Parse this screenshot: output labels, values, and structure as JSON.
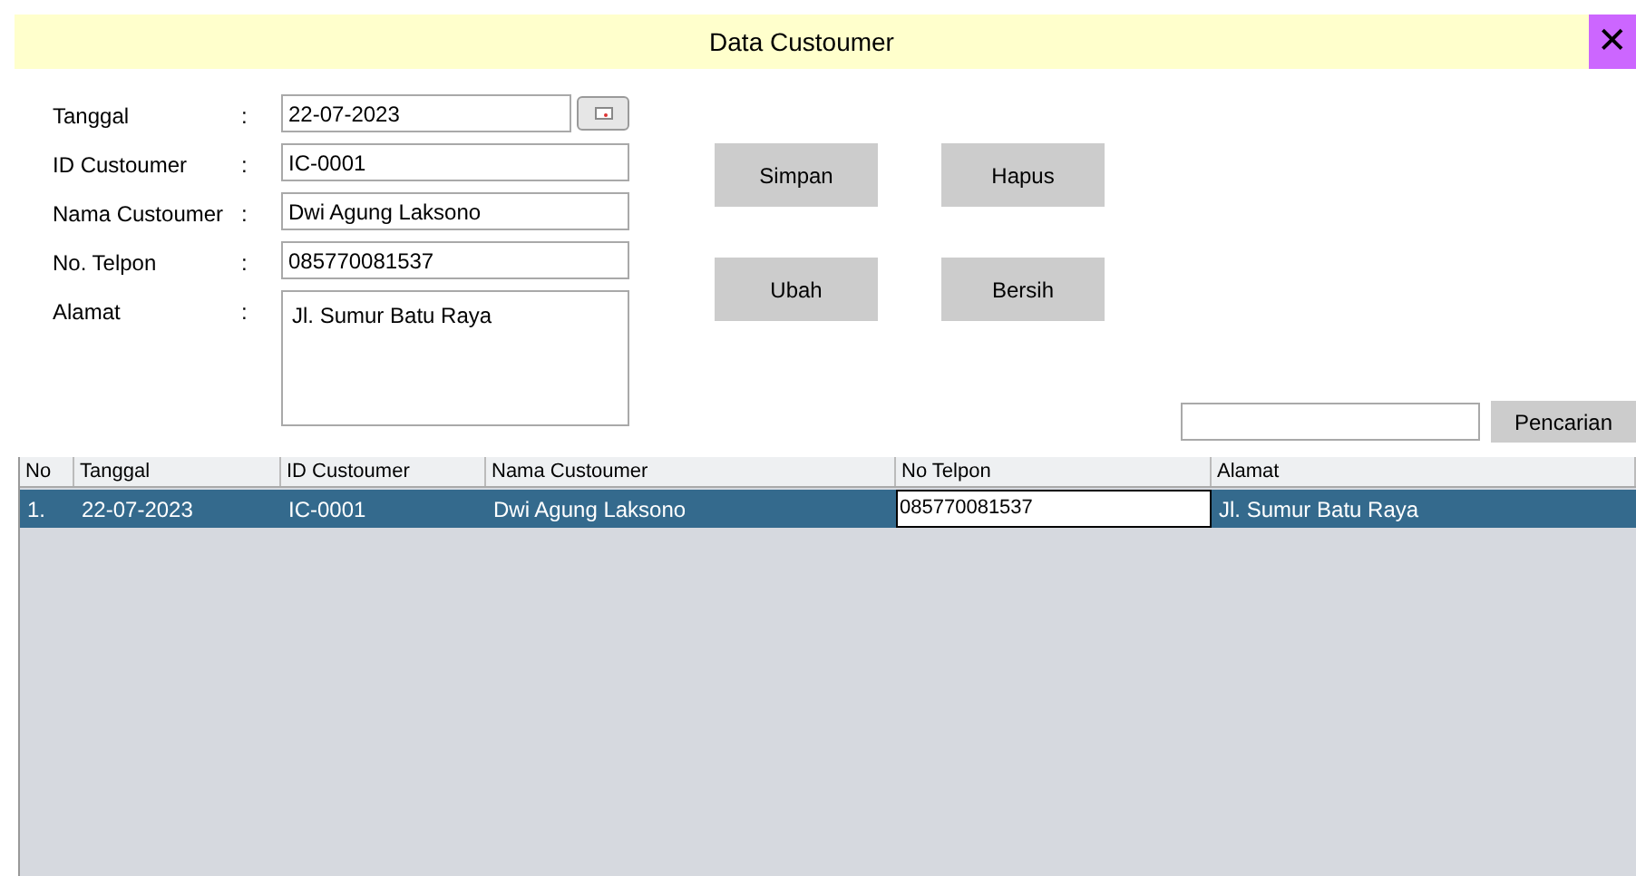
{
  "window": {
    "title": "Data Custoumer",
    "close": "✕"
  },
  "form": {
    "fields": [
      {
        "label": "Tanggal",
        "colon": ":",
        "value": "22-07-2023",
        "kind": "date"
      },
      {
        "label": "ID Custoumer",
        "colon": ":",
        "value": "IC-0001",
        "kind": "text"
      },
      {
        "label": "Nama Custoumer",
        "colon": ":",
        "value": "Dwi Agung Laksono",
        "kind": "text"
      },
      {
        "label": "No. Telpon",
        "colon": ":",
        "value": "085770081537",
        "kind": "text"
      },
      {
        "label": "Alamat",
        "colon": ":",
        "value": "Jl. Sumur Batu Raya",
        "kind": "textarea"
      }
    ]
  },
  "buttons": [
    "Simpan",
    "Hapus",
    "Ubah",
    "Bersih"
  ],
  "search": {
    "button": "Pencarian"
  },
  "table": {
    "columns": [
      "No",
      "Tanggal",
      "ID Custoumer",
      "Nama Custoumer",
      "No Telpon",
      "Alamat"
    ],
    "rows": [
      {
        "selected": true,
        "cells": [
          {
            "text": "1.",
            "editing": false
          },
          {
            "text": "22-07-2023",
            "editing": false
          },
          {
            "text": "IC-0001",
            "editing": false
          },
          {
            "text": "Dwi Agung Laksono",
            "editing": false
          },
          {
            "text": "085770081537",
            "editing": true
          },
          {
            "text": "Jl. Sumur Batu Raya",
            "editing": false
          }
        ]
      }
    ]
  }
}
